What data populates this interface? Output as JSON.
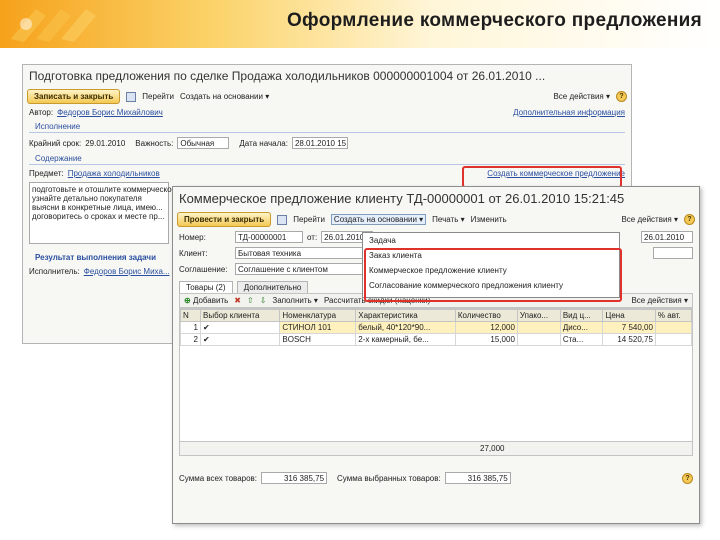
{
  "slide": {
    "title": "Оформление коммерческого предложения"
  },
  "back_window": {
    "title": "Подготовка предложения по сделке Продажа холодильников 000000001004 от 26.01.2010 ...",
    "toolbar": {
      "save_close": "Записать и закрыть",
      "go_to": "Перейти",
      "create_basis": "Создать на основании",
      "all_actions": "Все действия"
    },
    "author_label": "Автор:",
    "author_value": "Федоров Борис Михайлович",
    "additional_info": "Дополнительная информация",
    "execution_section": "Исполнение",
    "deadline_label": "Крайний срок:",
    "deadline_value": "29.01.2010",
    "importance_label": "Важность:",
    "importance_value": "Обычная",
    "start_date_label": "Дата начала:",
    "start_date_value": "28.01.2010 15",
    "content_section": "Содержание",
    "subject_label": "Предмет:",
    "subject_value": "Продажа холодильников",
    "create_offer_link": "Создать коммерческое предложение",
    "description_lines": [
      "подготовьте и отошлите коммерческое",
      "узнайте детально покупателя",
      "выясни в конкретные лица, имею...",
      "договоритесь о сроках и месте пр..."
    ],
    "result_section": "Результат выполнения задачи",
    "performer_label": "Исполнитель:",
    "performer_value": "Федоров Борис Миха..."
  },
  "front_window": {
    "title": "Коммерческое предложение клиенту ТД-00000001 от 26.01.2010 15:21:45",
    "toolbar": {
      "post_close": "Провести и закрыть",
      "go_to": "Перейти",
      "create_basis": "Создать на основании",
      "print": "Печать",
      "change": "Изменить",
      "all_actions": "Все действия"
    },
    "number_label": "Номер:",
    "number_value": "ТД-00000001",
    "date_label": "от:",
    "date_value": "26.01.2010",
    "client_label": "Клиент:",
    "client_value": "Бытовая техника",
    "agreement_label": "Соглашение:",
    "agreement_value": "Соглашение с клиентом",
    "right_date_value": "26.01.2010",
    "tabs": [
      "Товары (2)",
      "Дополнительно"
    ],
    "table_toolbar": {
      "add": "Добавить",
      "fill": "Заполнить",
      "recalc": "Рассчитать скидки (наценки)",
      "all_actions": "Все действия"
    },
    "columns": [
      "N",
      "Выбор клиента",
      "Номенклатура",
      "Характеристика",
      "Количество",
      "Упако...",
      "Вид ц...",
      "Цена",
      "% авт."
    ],
    "rows": [
      {
        "n": "1",
        "choice": "✔",
        "item": "СТИНОЛ 101",
        "char": "белый, 40*120*90...",
        "qty": "12,000",
        "pack": "",
        "price_type": "Дисо...",
        "price": "7 540,00",
        "auto": ""
      },
      {
        "n": "2",
        "choice": "✔",
        "item": "BOSCH",
        "char": "2-х камерный, бе...",
        "qty": "15,000",
        "pack": "",
        "price_type": "Ста...",
        "price": "14 520,75",
        "auto": ""
      }
    ],
    "total_qty": "27,000",
    "sum_all_label": "Сумма всех товаров:",
    "sum_all_value": "316 385,75",
    "sum_selected_label": "Сумма выбранных товаров:",
    "sum_selected_value": "316 385,75"
  },
  "dropdown_menu": {
    "items": [
      "Задача",
      "Заказ клиента",
      "Коммерческое предложение клиенту",
      "Согласование коммерческого предложения клиенту"
    ]
  },
  "colors": {
    "highlight_red": "#e0322d",
    "link_blue": "#2a4fa0",
    "accent_orange": "#f6a21b"
  }
}
